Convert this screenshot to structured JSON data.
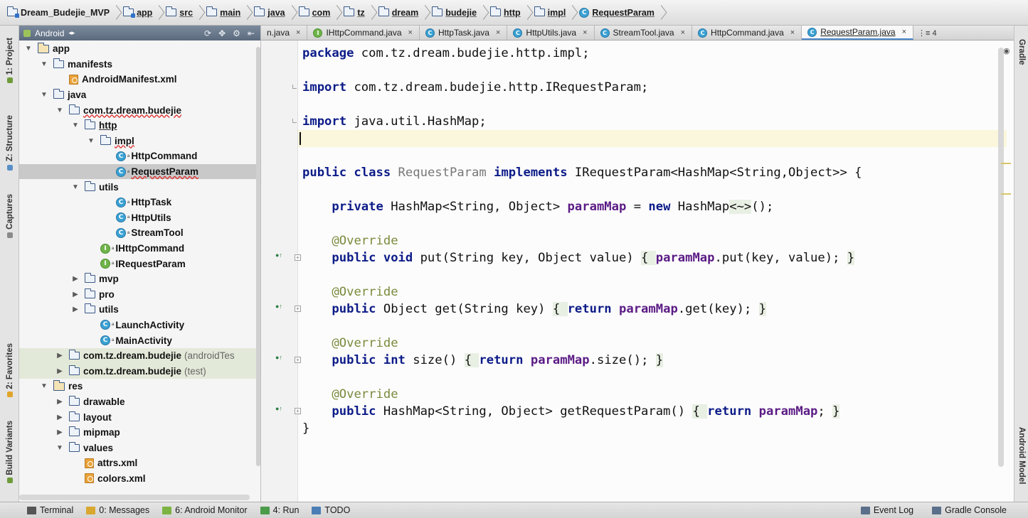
{
  "breadcrumb": [
    {
      "label": "Dream_Budejie_MVP",
      "icon": "module-folder-icon"
    },
    {
      "label": "app",
      "icon": "module-folder-icon"
    },
    {
      "label": "src",
      "icon": "folder-icon"
    },
    {
      "label": "main",
      "icon": "folder-icon"
    },
    {
      "label": "java",
      "icon": "folder-icon"
    },
    {
      "label": "com",
      "icon": "folder-icon"
    },
    {
      "label": "tz",
      "icon": "folder-icon"
    },
    {
      "label": "dream",
      "icon": "folder-icon"
    },
    {
      "label": "budejie",
      "icon": "folder-icon"
    },
    {
      "label": "http",
      "icon": "folder-icon"
    },
    {
      "label": "impl",
      "icon": "folder-icon"
    },
    {
      "label": "RequestParam",
      "icon": "class-icon"
    }
  ],
  "project_panel": {
    "view_selector": "Android",
    "tree": [
      {
        "label": "app",
        "depth": 0,
        "state": "open",
        "icon": "module-folder",
        "kind": "folder"
      },
      {
        "label": "manifests",
        "depth": 1,
        "state": "open",
        "icon": "folder",
        "kind": "folder"
      },
      {
        "label": "AndroidManifest.xml",
        "depth": 2,
        "state": "none",
        "icon": "xml",
        "kind": "file"
      },
      {
        "label": "java",
        "depth": 1,
        "state": "open",
        "icon": "folder",
        "kind": "folder"
      },
      {
        "label": "com.tz.dream.budejie",
        "depth": 2,
        "state": "open",
        "icon": "package",
        "kind": "folder",
        "style": "wavy"
      },
      {
        "label": "http",
        "depth": 3,
        "state": "open",
        "icon": "package",
        "kind": "folder",
        "style": "underline"
      },
      {
        "label": "impl",
        "depth": 4,
        "state": "open",
        "icon": "package",
        "kind": "folder",
        "style": "wavy"
      },
      {
        "label": "HttpCommand",
        "depth": 5,
        "state": "none",
        "icon": "class",
        "kind": "file"
      },
      {
        "label": "RequestParam",
        "depth": 5,
        "state": "none",
        "icon": "class",
        "kind": "file",
        "style": "wavy",
        "selected": true
      },
      {
        "label": "utils",
        "depth": 3,
        "state": "open",
        "icon": "package",
        "kind": "folder"
      },
      {
        "label": "HttpTask",
        "depth": 5,
        "state": "none",
        "icon": "class",
        "kind": "file"
      },
      {
        "label": "HttpUtils",
        "depth": 5,
        "state": "none",
        "icon": "class",
        "kind": "file"
      },
      {
        "label": "StreamTool",
        "depth": 5,
        "state": "none",
        "icon": "class",
        "kind": "file"
      },
      {
        "label": "IHttpCommand",
        "depth": 4,
        "state": "none",
        "icon": "interface",
        "kind": "file"
      },
      {
        "label": "IRequestParam",
        "depth": 4,
        "state": "none",
        "icon": "interface",
        "kind": "file"
      },
      {
        "label": "mvp",
        "depth": 3,
        "state": "closed",
        "icon": "package",
        "kind": "folder"
      },
      {
        "label": "pro",
        "depth": 3,
        "state": "closed",
        "icon": "package",
        "kind": "folder"
      },
      {
        "label": "utils",
        "depth": 3,
        "state": "closed",
        "icon": "package",
        "kind": "folder"
      },
      {
        "label": "LaunchActivity",
        "depth": 4,
        "state": "none",
        "icon": "class",
        "kind": "file"
      },
      {
        "label": "MainActivity",
        "depth": 4,
        "state": "none",
        "icon": "class",
        "kind": "file"
      },
      {
        "label": "com.tz.dream.budejie",
        "sub": "(androidTes",
        "depth": 2,
        "state": "closed",
        "icon": "package",
        "kind": "folder",
        "tint": true
      },
      {
        "label": "com.tz.dream.budejie",
        "sub": "(test)",
        "depth": 2,
        "state": "closed",
        "icon": "package",
        "kind": "folder",
        "tint": true
      },
      {
        "label": "res",
        "depth": 1,
        "state": "open",
        "icon": "res-folder",
        "kind": "folder"
      },
      {
        "label": "drawable",
        "depth": 2,
        "state": "closed",
        "icon": "folder",
        "kind": "folder"
      },
      {
        "label": "layout",
        "depth": 2,
        "state": "closed",
        "icon": "folder",
        "kind": "folder"
      },
      {
        "label": "mipmap",
        "depth": 2,
        "state": "closed",
        "icon": "folder",
        "kind": "folder"
      },
      {
        "label": "values",
        "depth": 2,
        "state": "open",
        "icon": "folder",
        "kind": "folder"
      },
      {
        "label": "attrs.xml",
        "depth": 3,
        "state": "none",
        "icon": "xml",
        "kind": "file"
      },
      {
        "label": "colors.xml",
        "depth": 3,
        "state": "none",
        "icon": "xml",
        "kind": "file"
      }
    ]
  },
  "left_tool_tabs": [
    {
      "label": "1: Project",
      "color": "#6d9b3a"
    },
    {
      "label": "Z: Structure",
      "color": "#5a8fc8"
    },
    {
      "label": "Captures",
      "color": "#8a8a8a"
    },
    {
      "label": "2: Favorites",
      "color": "#e0a52a"
    },
    {
      "label": "Build Variants",
      "color": "#6d9b3a"
    }
  ],
  "right_tool_tabs": [
    {
      "label": "Gradle"
    },
    {
      "label": "Android Model"
    }
  ],
  "editor_tabs": [
    {
      "label": "n.java",
      "icon": "none",
      "active": false
    },
    {
      "label": "IHttpCommand.java",
      "icon": "interface",
      "active": false
    },
    {
      "label": "HttpTask.java",
      "icon": "class",
      "active": false
    },
    {
      "label": "HttpUtils.java",
      "icon": "class",
      "active": false
    },
    {
      "label": "StreamTool.java",
      "icon": "class",
      "active": false
    },
    {
      "label": "HttpCommand.java",
      "icon": "class",
      "active": false
    },
    {
      "label": "RequestParam.java",
      "icon": "class",
      "active": true
    }
  ],
  "tab_overflow": "⋮≡ 4",
  "code_lines": [
    [
      {
        "t": "package",
        "c": "kw"
      },
      {
        "t": " com.tz.dream.budejie.http.impl;"
      }
    ],
    [],
    [
      {
        "t": "import",
        "c": "kw"
      },
      {
        "t": " com.tz.dream.budejie.http.IRequestParam;"
      }
    ],
    [],
    [
      {
        "t": "import",
        "c": "kw"
      },
      {
        "t": " java.util.HashMap;"
      }
    ],
    [],
    [],
    [
      {
        "t": "public class",
        "c": "kw"
      },
      {
        "t": " "
      },
      {
        "t": "RequestParam",
        "c": "grey"
      },
      {
        "t": " "
      },
      {
        "t": "implements",
        "c": "kw"
      },
      {
        "t": " IRequestParam<HashMap<String,Object>> {"
      }
    ],
    [],
    [
      {
        "t": "    "
      },
      {
        "t": "private",
        "c": "kw"
      },
      {
        "t": " HashMap<String, Object> "
      },
      {
        "t": "paramMap",
        "c": "field"
      },
      {
        "t": " = "
      },
      {
        "t": "new",
        "c": "kw"
      },
      {
        "t": " HashMap"
      },
      {
        "t": "<~>",
        "c": "hl"
      },
      {
        "t": "();"
      }
    ],
    [],
    [
      {
        "t": "    "
      },
      {
        "t": "@Override",
        "c": "ann"
      }
    ],
    [
      {
        "t": "    "
      },
      {
        "t": "public void",
        "c": "kw"
      },
      {
        "t": " put(String key, Object value) "
      },
      {
        "t": "{ ",
        "c": "hl"
      },
      {
        "t": "paramMap",
        "c": "field"
      },
      {
        "t": ".put(key, value); "
      },
      {
        "t": "}",
        "c": "hl"
      }
    ],
    [],
    [
      {
        "t": "    "
      },
      {
        "t": "@Override",
        "c": "ann"
      }
    ],
    [
      {
        "t": "    "
      },
      {
        "t": "public",
        "c": "kw"
      },
      {
        "t": " Object get(String key) "
      },
      {
        "t": "{ ",
        "c": "hl"
      },
      {
        "t": "return",
        "c": "kw"
      },
      {
        "t": " "
      },
      {
        "t": "paramMap",
        "c": "field"
      },
      {
        "t": ".get(key); "
      },
      {
        "t": "}",
        "c": "hl"
      }
    ],
    [],
    [
      {
        "t": "    "
      },
      {
        "t": "@Override",
        "c": "ann"
      }
    ],
    [
      {
        "t": "    "
      },
      {
        "t": "public int",
        "c": "kw"
      },
      {
        "t": " size() "
      },
      {
        "t": "{ ",
        "c": "hl"
      },
      {
        "t": "return",
        "c": "kw"
      },
      {
        "t": " "
      },
      {
        "t": "paramMap",
        "c": "field"
      },
      {
        "t": ".size(); "
      },
      {
        "t": "}",
        "c": "hl"
      }
    ],
    [],
    [
      {
        "t": "    "
      },
      {
        "t": "@Override",
        "c": "ann"
      }
    ],
    [
      {
        "t": "    "
      },
      {
        "t": "public",
        "c": "kw"
      },
      {
        "t": " HashMap<String, Object> getRequestParam() "
      },
      {
        "t": "{ ",
        "c": "hl"
      },
      {
        "t": "return",
        "c": "kw"
      },
      {
        "t": " "
      },
      {
        "t": "paramMap",
        "c": "field"
      },
      {
        "t": "; "
      },
      {
        "t": "}",
        "c": "hl"
      }
    ],
    [
      {
        "t": "}"
      }
    ]
  ],
  "bottom_bar": {
    "left": [
      {
        "label": "Terminal",
        "icon": "terminal-icon",
        "color": "#555555"
      },
      {
        "label": "0: Messages",
        "icon": "messages-icon",
        "color": "#d9a830"
      },
      {
        "label": "6: Android Monitor",
        "icon": "android-icon",
        "color": "#7cb342"
      },
      {
        "label": "4: Run",
        "icon": "run-icon",
        "color": "#4a9b4a"
      },
      {
        "label": "TODO",
        "icon": "todo-icon",
        "color": "#4a7fb5"
      }
    ],
    "right": [
      {
        "label": "Event Log",
        "icon": "event-log-icon",
        "color": "#5a6f8a"
      },
      {
        "label": "Gradle Console",
        "icon": "gradle-console-icon",
        "color": "#5a6f8a"
      }
    ]
  }
}
